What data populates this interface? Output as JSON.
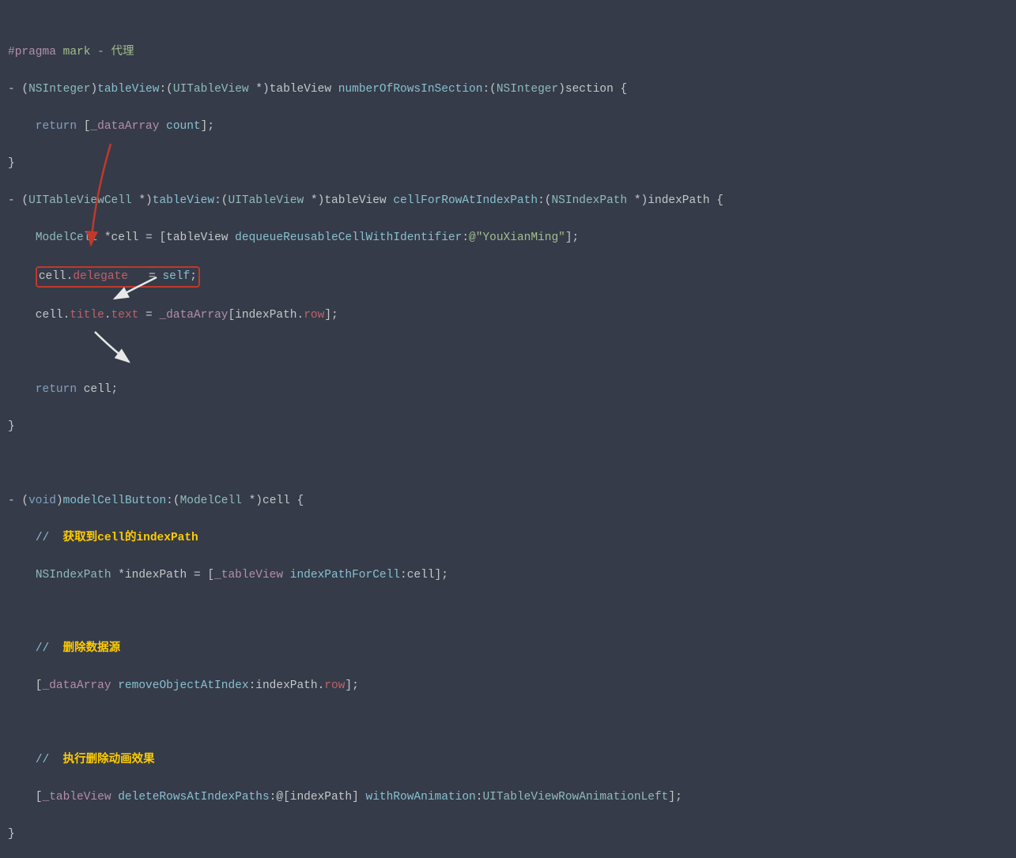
{
  "l1_pragma": "#pragma",
  "l1_mark": " mark - ",
  "l1_cn": "代理",
  "l2_minus": "- (",
  "l2_nsint": "NSInteger",
  "l2_rparen": ")",
  "l2_tv": "tableView",
  "l2_colon": ":(",
  "l2_uitv": "UITableView",
  "l2_star": " *)",
  "l2_tv2": "tableView ",
  "l2_nrows": "numberOfRowsInSection",
  "l2_colon2": ":(",
  "l2_nsint2": "NSInteger",
  "l2_rparen2": ")",
  "l2_section": "section {",
  "l3_return": "    return",
  "l3_lb": " [",
  "l3_data": "_dataArray",
  "l3_space": " ",
  "l3_count": "count",
  "l3_rb": "];",
  "l4_close": "}",
  "l5_minus": "- (",
  "l5_uitvc": "UITableViewCell",
  "l5_star": " *)",
  "l5_tv": "tableView",
  "l5_colon": ":(",
  "l5_uitv": "UITableView",
  "l5_star2": " *)",
  "l5_tv2": "tableView ",
  "l5_cfrip": "cellForRowAtIndexPath",
  "l5_colon2": ":(",
  "l5_nsip": "NSIndexPath",
  "l5_star3": " *)",
  "l5_ip": "indexPath {",
  "l6_pad": "    ",
  "l6_mc": "ModelCell",
  "l6_cell": " *cell = [tableView ",
  "l6_deq": "dequeueReusableCellWithIdentifier",
  "l6_colon": ":",
  "l6_str": "@\"YouXianMing\"",
  "l6_rb": "];",
  "l7_pad": "    ",
  "l7_cell": "cell",
  "l7_dot": ".",
  "l7_del": "delegate",
  "l7_eq": "   = ",
  "l7_self": "self",
  "l7_semi": ";",
  "l8_pad": "    cell.",
  "l8_title": "title",
  "l8_dot": ".",
  "l8_text": "text",
  "l8_eq": " = ",
  "l8_data": "_dataArray",
  "l8_lb": "[indexPath.",
  "l8_row": "row",
  "l8_rb": "];",
  "l10_return": "    return",
  "l10_cell": " cell;",
  "l11_close": "}",
  "l13_minus": "- (",
  "l13_void": "void",
  "l13_rparen": ")",
  "l13_mcb": "modelCellButton",
  "l13_colon": ":(",
  "l13_mc": "ModelCell",
  "l13_star": " *)",
  "l13_cell": "cell {",
  "l14_pad": "    ",
  "l14_slash": "//  ",
  "l14_cn1": "获取到",
  "l14_code1": "cell",
  "l14_cn2": "的",
  "l14_code2": "indexPath",
  "l15_pad": "    ",
  "l15_nsip": "NSIndexPath",
  "l15_decl": " *indexPath = [",
  "l15_tv": "_tableView",
  "l15_space": " ",
  "l15_ipfc": "indexPathForCell",
  "l15_colon": ":cell];",
  "l17_pad": "    ",
  "l17_slash": "//  ",
  "l17_cn": "删除数据源",
  "l18_pad": "    [",
  "l18_data": "_dataArray",
  "l18_space": " ",
  "l18_roai": "removeObjectAtIndex",
  "l18_colon": ":indexPath.",
  "l18_row": "row",
  "l18_rb": "];",
  "l20_pad": "    ",
  "l20_slash": "//  ",
  "l20_cn": "执行删除动画效果",
  "l21_pad": "    [",
  "l21_tv": "_tableView",
  "l21_space": " ",
  "l21_drip": "deleteRowsAtIndexPaths",
  "l21_arr": ":@[indexPath] ",
  "l21_wra": "withRowAnimation",
  "l21_colon": ":",
  "l21_enum": "UITableViewRowAnimationLeft",
  "l21_rb": "];",
  "l22_close": "}"
}
